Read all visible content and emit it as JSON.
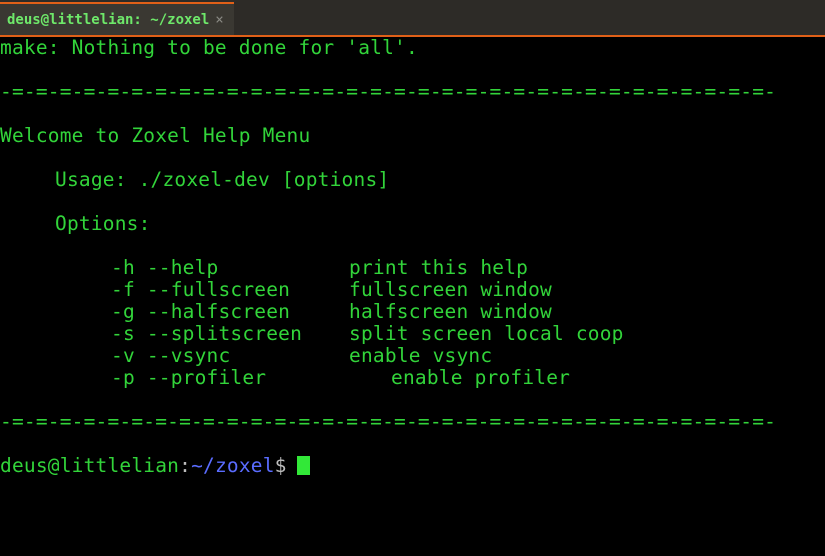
{
  "tab": {
    "title": "deus@littlelian: ~/zoxel",
    "close_glyph": "×"
  },
  "colors": {
    "text": "#32d43a",
    "path": "#5a6cff",
    "accent": "#e06018",
    "cursor": "#32e838"
  },
  "terminal": {
    "make_line": "make: Nothing to be done for 'all'.",
    "separator": "-=-=-=-=-=-=-=-=-=-=-=-=-=-=-=-=-=-=-=-=-=-=-=-=-=-=-=-=-=-=-=-=-",
    "welcome": "Welcome to Zoxel Help Menu",
    "usage": "Usage: ./zoxel-dev [options]",
    "options_header": "Options:",
    "options": [
      {
        "flag": "-h --help",
        "desc": "print this help"
      },
      {
        "flag": "-f --fullscreen",
        "desc": "fullscreen window"
      },
      {
        "flag": "-g --halfscreen",
        "desc": "halfscreen window"
      },
      {
        "flag": "-s --splitscreen",
        "desc": "split screen local coop"
      },
      {
        "flag": "-v --vsync",
        "desc": "enable vsync"
      },
      {
        "flag": "-p --profiler",
        "desc": "enable profiler"
      }
    ],
    "prompt": {
      "user_host": "deus@littlelian",
      "separator": ":",
      "path": "~/zoxel",
      "symbol": "$"
    }
  }
}
